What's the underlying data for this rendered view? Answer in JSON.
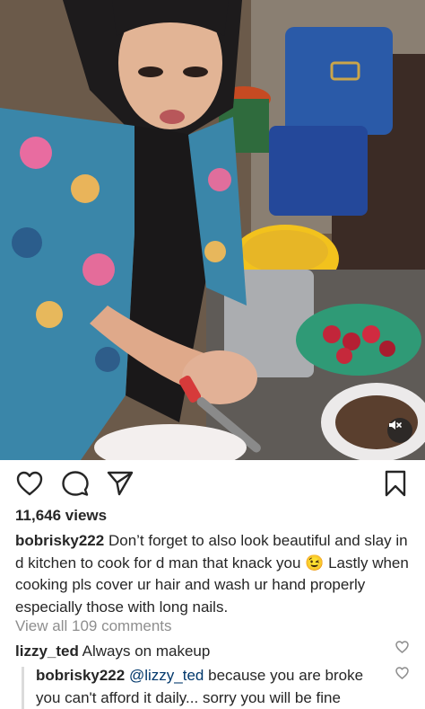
{
  "post": {
    "views": "11,646 views",
    "caption_user": "bobrisky222",
    "caption_text": "Don’t forget to also look beautiful and slay in d kitchen to cook for d man that knack you 😉 Lastly when cooking pls cover ur hair and wash ur hand properly especially those with long nails.",
    "view_comments": "View all 109 comments"
  },
  "comments": [
    {
      "user": "lizzy_ted",
      "text": "Always on makeup"
    }
  ],
  "reply": {
    "user": "bobrisky222",
    "mention": "@lizzy_ted",
    "text": "because you are broke you can't afford it daily... sorry you will be fine"
  },
  "icons": {
    "like": "heart-icon",
    "comment": "comment-bubble-icon",
    "share": "paper-plane-icon",
    "save": "bookmark-icon",
    "mute": "speaker-muted-icon",
    "comment_like": "heart-icon"
  },
  "colors": {
    "text": "#262626",
    "muted": "#8e8e8e",
    "mention": "#00376b"
  }
}
